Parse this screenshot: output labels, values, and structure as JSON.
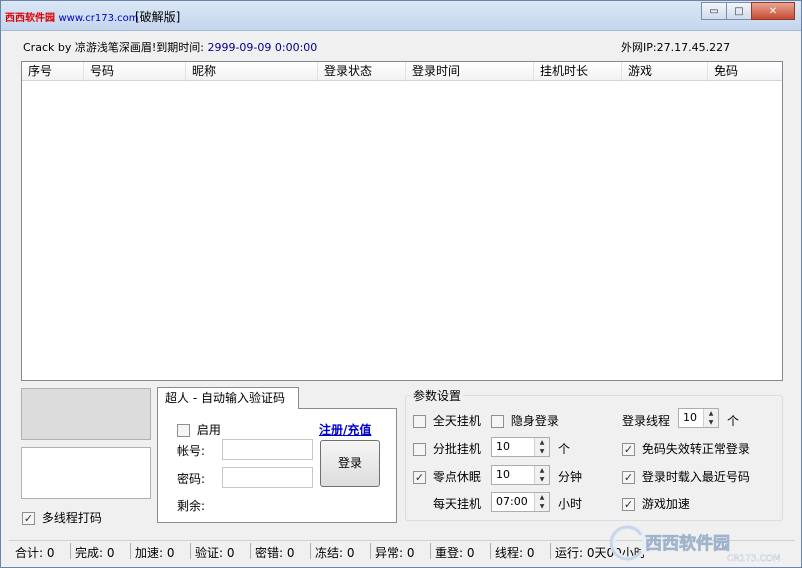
{
  "window": {
    "title_logo": "西西软件园",
    "title_site": "www.cr173.com",
    "title_suffix": "[破解版]",
    "controls": {
      "minimize": "▭",
      "maximize": "□",
      "close": "✕"
    }
  },
  "info": {
    "crack_label": "Crack by 凉游浅笔深画眉!到期时间:",
    "expiry": "2999-09-09 0:00:00",
    "ip_label": "外网IP:",
    "ip": "27.17.45.227"
  },
  "grid": {
    "columns": [
      "序号",
      "号码",
      "昵称",
      "登录状态",
      "登录时间",
      "挂机时长",
      "游戏",
      "免码"
    ]
  },
  "multithread": {
    "label": "多线程打码",
    "checked": true
  },
  "login_tab": {
    "tab_label": "超人 - 自动输入验证码",
    "enable_label": "启用",
    "enable_checked": false,
    "register_link": "注册/充值",
    "account_label": "帐号:",
    "password_label": "密码:",
    "remaining_label": "剩余:",
    "login_button": "登录"
  },
  "params": {
    "legend": "参数设置",
    "allday": {
      "label": "全天挂机",
      "checked": false
    },
    "stealth": {
      "label": "隐身登录",
      "checked": false
    },
    "thread_label": "登录线程",
    "thread_value": "10",
    "thread_unit": "个",
    "batch": {
      "label": "分批挂机",
      "checked": false
    },
    "batch_value": "10",
    "batch_unit": "个",
    "code_fallback": {
      "label": "免码失效转正常登录",
      "checked": true
    },
    "midnight": {
      "label": "零点休眠",
      "checked": true
    },
    "midnight_value": "10",
    "midnight_unit": "分钟",
    "recent": {
      "label": "登录时载入最近号码",
      "checked": true
    },
    "daily_label": "每天挂机",
    "daily_value": "07:00",
    "daily_unit": "小时",
    "accel": {
      "label": "游戏加速",
      "checked": true
    }
  },
  "status": [
    {
      "label": "合计:",
      "value": "0"
    },
    {
      "label": "完成:",
      "value": "0"
    },
    {
      "label": "加速:",
      "value": "0"
    },
    {
      "label": "验证:",
      "value": "0"
    },
    {
      "label": "密错:",
      "value": "0"
    },
    {
      "label": "冻结:",
      "value": "0"
    },
    {
      "label": "异常:",
      "value": "0"
    },
    {
      "label": "重登:",
      "value": "0"
    },
    {
      "label": "线程:",
      "value": "0"
    },
    {
      "label": "运行:",
      "value": "0天00小时"
    }
  ],
  "watermark": {
    "brand": "西西软件园",
    "site": "CR173.COM"
  },
  "colors": {
    "link": "#0000cc",
    "date": "#00008b",
    "close": "#c74a32"
  }
}
